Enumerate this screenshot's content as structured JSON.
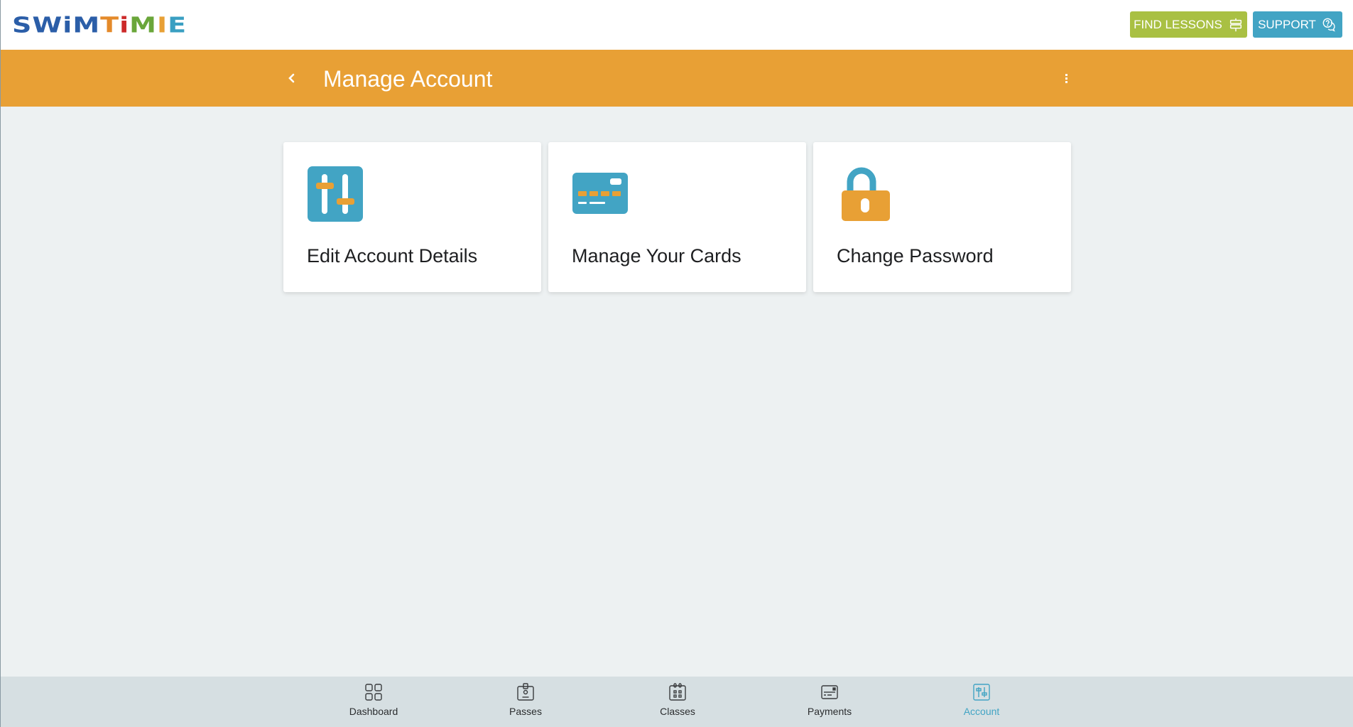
{
  "header": {
    "logo_letters": [
      {
        "char": "S",
        "color": "#2b5ea8"
      },
      {
        "char": "W",
        "color": "#2b5ea8"
      },
      {
        "char": "i",
        "color": "#2b5ea8"
      },
      {
        "char": "M",
        "color": "#2b5ea8"
      },
      {
        "char": "T",
        "color": "#e48a2a"
      },
      {
        "char": "i",
        "color": "#cc2a2a"
      },
      {
        "char": "M",
        "color": "#6aa63a"
      },
      {
        "char": "I",
        "color": "#e8a035"
      },
      {
        "char": "E",
        "color": "#3a9fc2"
      }
    ],
    "find_lessons_label": "FIND LESSONS",
    "support_label": "SUPPORT"
  },
  "appbar": {
    "title": "Manage Account"
  },
  "cards": [
    {
      "label": "Edit Account Details",
      "icon": "sliders-icon"
    },
    {
      "label": "Manage Your Cards",
      "icon": "credit-card-icon"
    },
    {
      "label": "Change Password",
      "icon": "lock-icon"
    }
  ],
  "bottom_nav": {
    "items": [
      {
        "label": "Dashboard",
        "icon": "grid-icon",
        "active": false
      },
      {
        "label": "Passes",
        "icon": "badge-icon",
        "active": false
      },
      {
        "label": "Classes",
        "icon": "calendar-icon",
        "active": false
      },
      {
        "label": "Payments",
        "icon": "card-icon",
        "active": false
      },
      {
        "label": "Account",
        "icon": "sliders-icon",
        "active": true
      }
    ]
  },
  "colors": {
    "brand_orange": "#e8a035",
    "brand_blue": "#42a4c4",
    "brand_green": "#a9c043"
  }
}
